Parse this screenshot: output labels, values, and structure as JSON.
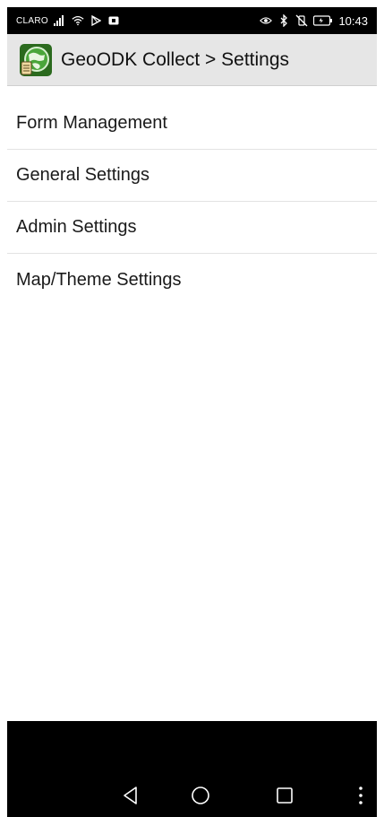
{
  "status_bar": {
    "carrier": "CLARO",
    "time": "10:43",
    "left_icons": [
      "signal-icon",
      "wifi-icon",
      "play-store-icon",
      "notification-icon"
    ],
    "right_icons": [
      "eye-comfort-icon",
      "bluetooth-icon",
      "vibrate-icon",
      "battery-icon"
    ]
  },
  "action_bar": {
    "title": "GeoODK Collect > Settings",
    "icon": "geoodk-app-icon"
  },
  "settings": {
    "items": [
      {
        "label": "Form Management"
      },
      {
        "label": "General Settings"
      },
      {
        "label": "Admin Settings"
      },
      {
        "label": "Map/Theme Settings"
      }
    ]
  },
  "nav_bar": {
    "buttons": [
      "back-icon",
      "home-icon",
      "recents-icon",
      "more-icon"
    ]
  },
  "colors": {
    "status_bar": "#000000",
    "action_bar": "#e6e6e6",
    "background": "#ffffff",
    "divider": "#e3e3e3",
    "nav_bar": "#000000"
  }
}
